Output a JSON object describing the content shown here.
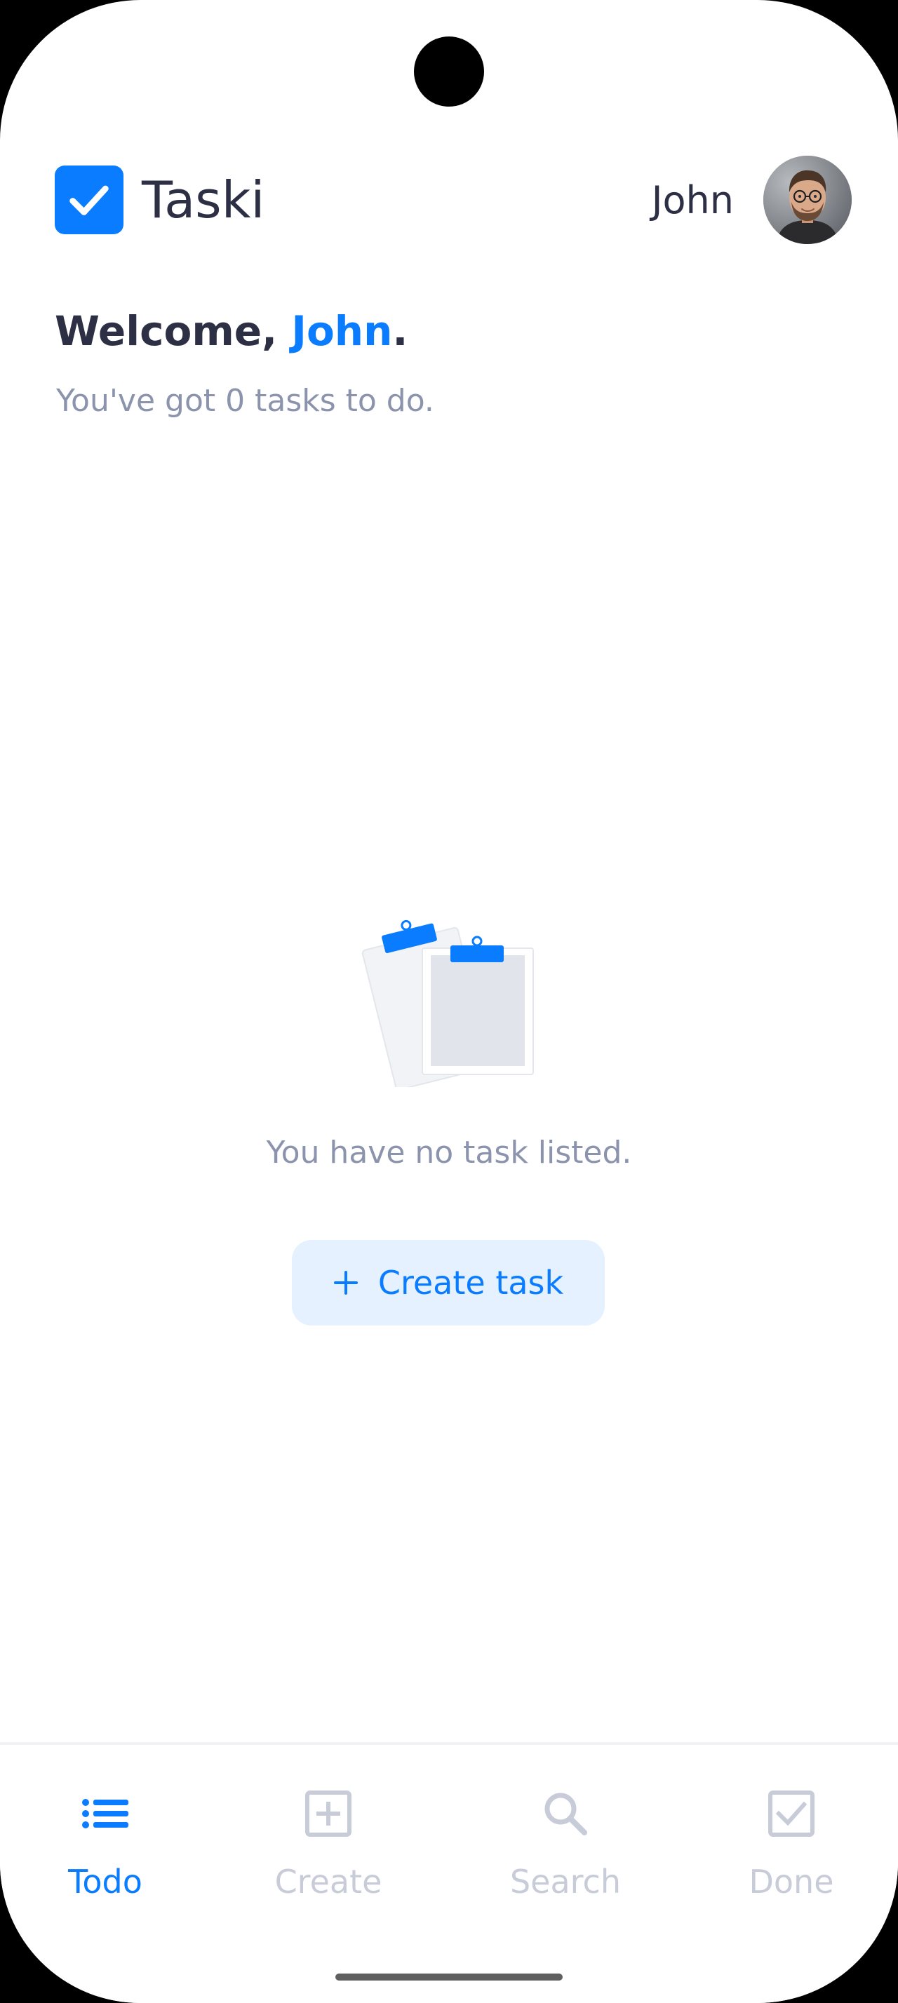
{
  "app": {
    "name": "Taski",
    "user_name": "John"
  },
  "welcome": {
    "prefix": "Welcome, ",
    "name": "John",
    "suffix": ".",
    "subtitle": "You've got 0 tasks to do."
  },
  "empty_state": {
    "message": "You have no task listed.",
    "button_label": "Create task"
  },
  "nav": {
    "items": [
      {
        "label": "Todo",
        "icon": "list-icon",
        "active": true
      },
      {
        "label": "Create",
        "icon": "add-square-icon",
        "active": false
      },
      {
        "label": "Search",
        "icon": "search-icon",
        "active": false
      },
      {
        "label": "Done",
        "icon": "checkbox-icon",
        "active": false
      }
    ]
  },
  "colors": {
    "accent": "#0a7cff",
    "text_dark": "#2d2f45",
    "text_muted": "#8b93ad",
    "nav_inactive": "#c7ccd8",
    "button_bg": "#e5f1fe"
  }
}
